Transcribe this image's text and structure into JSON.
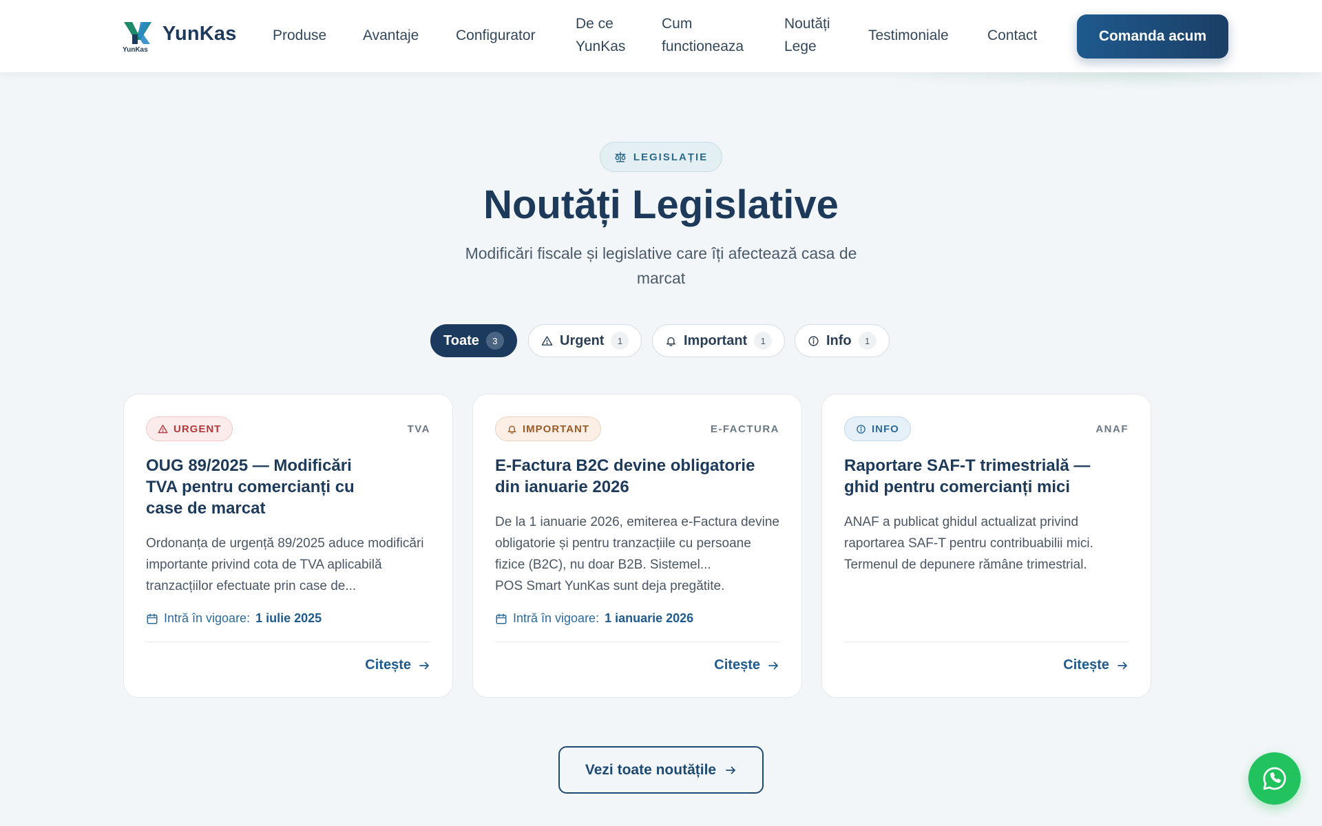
{
  "header": {
    "brand": "YunKas",
    "logo_caption": "YunKas",
    "nav": [
      {
        "label_lines": [
          "Produse"
        ]
      },
      {
        "label_lines": [
          "Avantaje"
        ]
      },
      {
        "label_lines": [
          "Configurator"
        ]
      },
      {
        "label_lines": [
          "De ce",
          "YunKas"
        ]
      },
      {
        "label_lines": [
          "Cum",
          "functioneaza"
        ]
      },
      {
        "label_lines": [
          "Noutăți",
          "Lege"
        ]
      },
      {
        "label_lines": [
          "Testimoniale"
        ]
      },
      {
        "label_lines": [
          "Contact"
        ]
      }
    ],
    "cta_label": "Comanda acum"
  },
  "hero": {
    "eyebrow": "LEGISLAȚIE",
    "eyebrow_icon": "scale-icon",
    "title": "Noutăți Legislative",
    "subtitle": "Modificări fiscale și legislative care îți afectează casa de marcat"
  },
  "filters": [
    {
      "label": "Toate",
      "count": "3",
      "active": true,
      "icon": ""
    },
    {
      "label": "Urgent",
      "count": "1",
      "active": false,
      "icon": "warning-icon"
    },
    {
      "label": "Important",
      "count": "1",
      "active": false,
      "icon": "bell-icon"
    },
    {
      "label": "Info",
      "count": "1",
      "active": false,
      "icon": "info-icon"
    }
  ],
  "cards": [
    {
      "badge": "URGENT",
      "tag": "TVA",
      "title": "OUG 89/2025 — Modificări TVA pentru comercianți cu case de marcat",
      "body": "Ordonanța de urgență 89/2025 aduce modificări importante privind cota de TVA aplicabilă tranzacțiilor efectuate prin case de...",
      "date_label": "Intră în vigoare:",
      "date_value": "1 iulie 2025",
      "link": "Citește"
    },
    {
      "badge": "IMPORTANT",
      "tag": "E-FACTURA",
      "title": "E-Factura B2C devine obligatorie din ianuarie 2026",
      "body": "De la 1 ianuarie 2026, emiterea e-Factura devine obligatorie și pentru tranzacțiile cu persoane fizice (B2C), nu doar B2B. Sistemel...",
      "tail": "POS Smart YunKas sunt deja pregătite.",
      "date_label": "Intră în vigoare:",
      "date_value": "1 ianuarie 2026",
      "link": "Citește"
    },
    {
      "badge": "INFO",
      "tag": "ANAF",
      "title": "Raportare SAF-T trimestrială — ghid pentru comercianți mici",
      "body": "ANAF a publicat ghidul actualizat privind raportarea SAF-T pentru contribuabilii mici. Termenul de depunere rămâne trimestrial.",
      "link": "Citește"
    }
  ],
  "see_all_label": "Vezi toate noutățile",
  "colors": {
    "primary": "#1e3a5a",
    "accent": "#1e5a8e",
    "urgent": "#b23a3a",
    "important": "#9a5a25",
    "info": "#2c6a9a",
    "whatsapp": "#22c35e"
  }
}
